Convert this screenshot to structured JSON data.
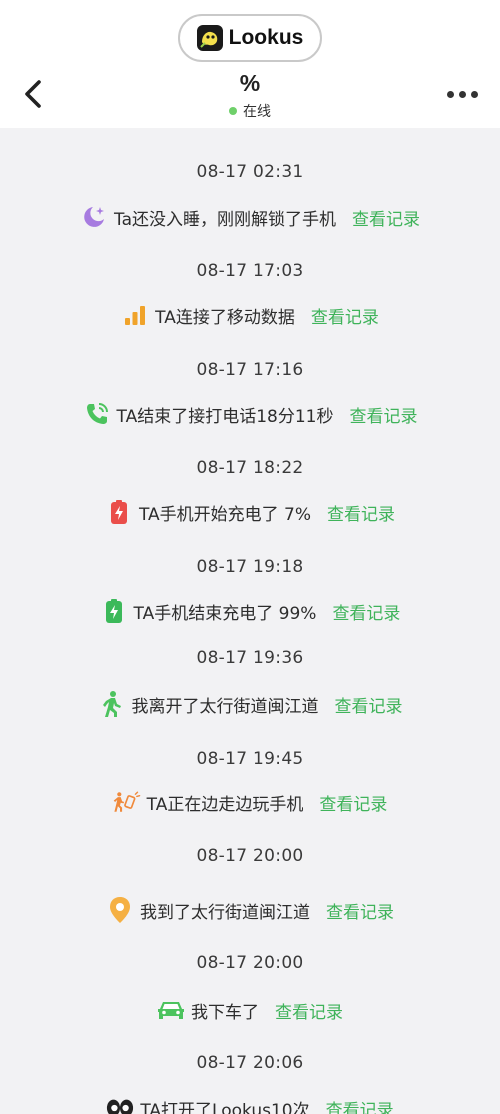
{
  "app": {
    "brand": "Lookus"
  },
  "header": {
    "title": "%",
    "status": "在线"
  },
  "colors": {
    "accent_green": "#3fb35a",
    "online_dot": "#6fd06a",
    "background": "#f2f2f4"
  },
  "feed": {
    "link_label": "查看记录",
    "entries": [
      {
        "time": "08-17 02:31",
        "icon": "moon-icon",
        "text": "Ta还没入睡，刚刚解锁了手机"
      },
      {
        "time": "08-17 17:03",
        "icon": "signal-bars-icon",
        "text": "TA连接了移动数据"
      },
      {
        "time": "08-17 17:16",
        "icon": "phone-call-icon",
        "text": "TA结束了接打电话18分11秒"
      },
      {
        "time": "08-17 18:22",
        "icon": "battery-charging-low-icon",
        "text": "TA手机开始充电了 7%"
      },
      {
        "time": "08-17 19:18",
        "icon": "battery-charging-full-icon",
        "text": "TA手机结束充电了 99%"
      },
      {
        "time": "08-17 19:36",
        "icon": "walking-person-icon",
        "text": "我离开了太行街道闽江道"
      },
      {
        "time": "08-17 19:45",
        "icon": "walking-with-phone-icon",
        "text": "TA正在边走边玩手机"
      },
      {
        "time": "08-17 20:00",
        "icon": "location-pin-icon",
        "text": "我到了太行街道闽江道"
      },
      {
        "time": "08-17 20:00",
        "icon": "car-icon",
        "text": "我下车了"
      },
      {
        "time": "08-17 20:06",
        "icon": "eyes-icon",
        "text": "TA打开了Lookus10次"
      }
    ]
  }
}
